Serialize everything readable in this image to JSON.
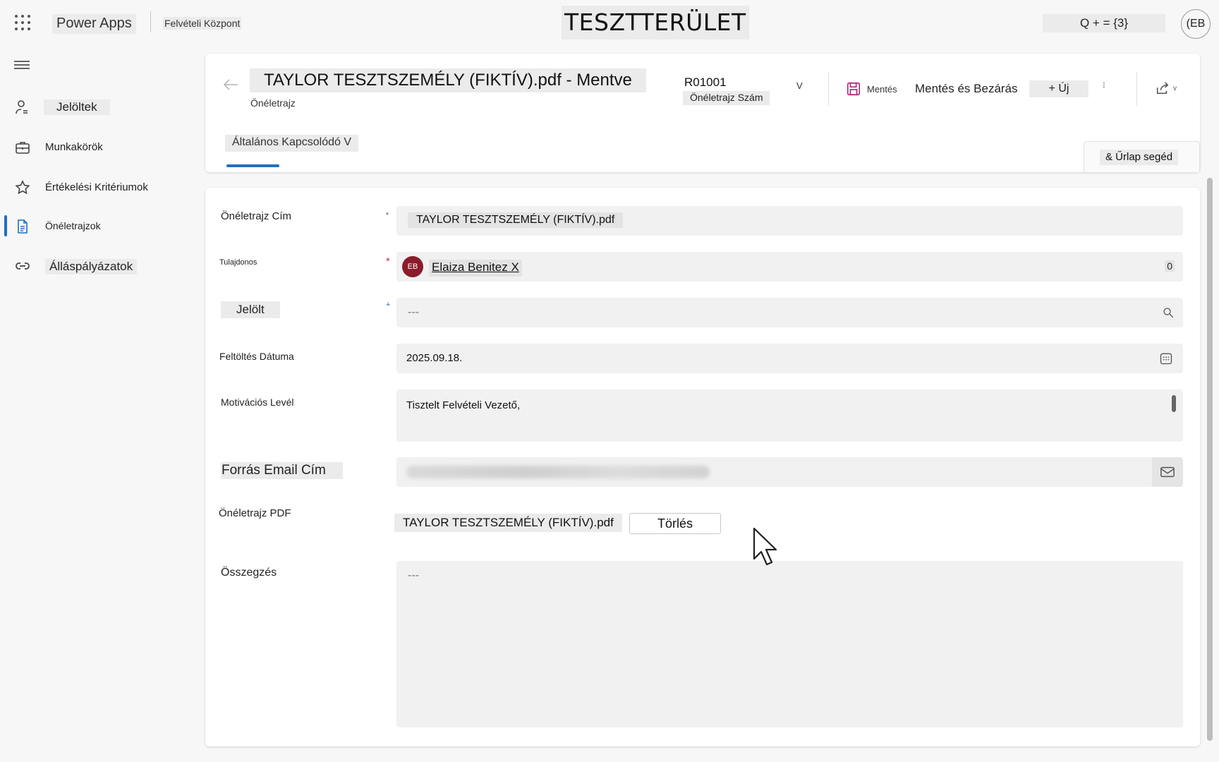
{
  "app": {
    "name": "Power Apps",
    "environment": "Felvételi Központ",
    "workspace": "TESZTTERÜLET",
    "search_text": "Q + = {3}",
    "user_initials": "(EB"
  },
  "sidebar": {
    "items": [
      {
        "label": "Jelöltek",
        "icon": "person-icon"
      },
      {
        "label": "Munkakörök",
        "icon": "briefcase-icon"
      },
      {
        "label": "Értékelési Kritériumok",
        "icon": "star-icon"
      },
      {
        "label": "Önéletrajzok",
        "icon": "document-icon",
        "active": true
      },
      {
        "label": "Álláspályázatok",
        "icon": "link-icon"
      }
    ]
  },
  "header": {
    "title": "TAYLOR TESZTSZEMÉLY (FIKTÍV).pdf - Mentve",
    "entity": "Önéletrajz",
    "record_number": "R01001",
    "record_number_label": "Önéletrajz Szám",
    "dropdown_glyph": "V",
    "commands": {
      "save": "Mentés",
      "save_close": "Mentés és Bezárás",
      "new": "+ Új",
      "more": "⁝",
      "share_chevron": "v"
    },
    "tab": "Általános Kapcsolódó V",
    "form_helper": "& Űrlap segéd"
  },
  "form": {
    "resume_title": {
      "label": "Önéletrajz Cím",
      "required_mark": "*",
      "value": "TAYLOR TESZTSZEMÉLY (FIKTÍV).pdf"
    },
    "owner": {
      "label": "Tulajdonos",
      "required_mark": "*",
      "avatar": "EB",
      "value": "Elaiza Benitez X",
      "count": "0"
    },
    "candidate": {
      "label": "Jelölt",
      "required_mark": "+",
      "placeholder": "---"
    },
    "upload_date": {
      "label": "Feltöltés Dátuma",
      "value": "2025.09.18."
    },
    "cover_letter": {
      "label": "Motivációs Levél",
      "value": "Tisztelt Felvételi Vezető,"
    },
    "source_email": {
      "label": "Forrás Email Cím"
    },
    "resume_pdf": {
      "label": "Önéletrajz PDF",
      "file_name": "TAYLOR TESZTSZEMÉLY (FIKTÍV).pdf",
      "delete_label": "Törlés"
    },
    "summary": {
      "label": "Összegzés",
      "placeholder": "---"
    }
  },
  "colors": {
    "accent": "#1f6fc5",
    "required": "#c4314b",
    "save_icon": "#b0287c",
    "avatar_bg": "#8a1c2b"
  }
}
